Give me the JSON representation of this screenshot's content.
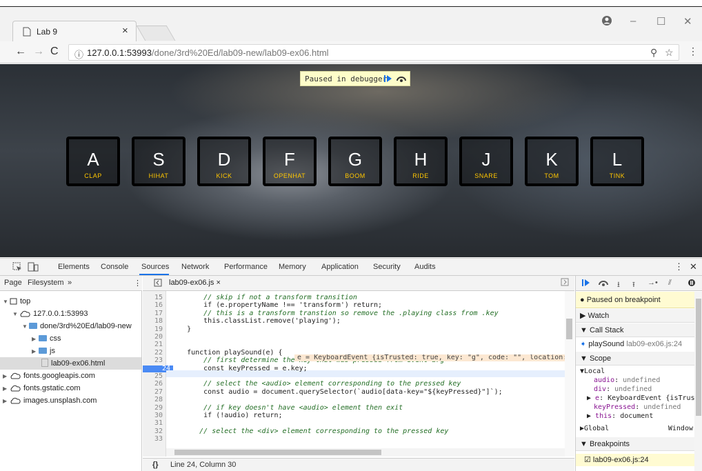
{
  "browser": {
    "tab_title": "Lab 9",
    "url_host": "127.0.0.1:53993",
    "url_path": "/done/3rd%20Ed/lab09-new/lab09-ex06.html"
  },
  "page": {
    "paused_label": "Paused in debugger",
    "keys": [
      {
        "key": "A",
        "sound": "clap"
      },
      {
        "key": "S",
        "sound": "hihat"
      },
      {
        "key": "D",
        "sound": "kick"
      },
      {
        "key": "F",
        "sound": "openhat"
      },
      {
        "key": "G",
        "sound": "boom"
      },
      {
        "key": "H",
        "sound": "ride"
      },
      {
        "key": "J",
        "sound": "snare"
      },
      {
        "key": "K",
        "sound": "tom"
      },
      {
        "key": "L",
        "sound": "tink"
      }
    ]
  },
  "devtools": {
    "tabs": [
      "Elements",
      "Console",
      "Sources",
      "Network",
      "Performance",
      "Memory",
      "Application",
      "Security",
      "Audits"
    ],
    "active_tab": "Sources",
    "navigator": {
      "tabs": [
        "Page",
        "Filesystem",
        "»"
      ],
      "tree": [
        "top",
        "127.0.0.1:53993",
        "done/3rd%20Ed/lab09-new",
        "css",
        "js",
        "lab09-ex06.html",
        "fonts.googleapis.com",
        "fonts.gstatic.com",
        "images.unsplash.com"
      ]
    },
    "editor": {
      "file_tab": "lab09-ex06.js ×",
      "line_numbers": [
        "15",
        "16",
        "17",
        "18",
        "19",
        "20",
        "21",
        "22",
        "23",
        "24",
        "25",
        "26",
        "27",
        "28",
        "29",
        "30",
        "31",
        "32",
        "33"
      ],
      "current_line": "24",
      "lines": [
        "        // skip if not a transform transition",
        "        if (e.propertyName !== 'transform') return;",
        "        // this is a transform transtion so remove the .playing class from .key",
        "        this.classList.remove('playing');",
        "    }",
        "",
        "",
        "    function playSound(e) {",
        "        // first determine the key that was pressed from event arg",
        "        const keyPressed = e.key;",
        "",
        "        // select the <audio> element corresponding to the pressed key",
        "        const audio = document.querySelector(`audio[data-key=\"${keyPressed}\"]`);",
        "",
        "        // if key doesn't have <audio> element then exit",
        "        if (!audio) return;",
        "",
        "       // select the <div> element corresponding to the pressed key",
        ""
      ],
      "inline_value": "e = KeyboardEvent {isTrusted: true, key: \"g\", code: \"\", location:",
      "status": "Line 24, Column 30"
    },
    "debugger": {
      "paused_text": "Paused on breakpoint",
      "watch": "Watch",
      "call_stack": "Call Stack",
      "frame_fn": "playSound",
      "frame_loc": "lab09-ex06.js:24",
      "scope": "Scope",
      "local": "Local",
      "vars": [
        {
          "name": "audio",
          "value": "undefined"
        },
        {
          "name": "div",
          "value": "undefined"
        },
        {
          "name": "e",
          "value": "KeyboardEvent {isTrust"
        },
        {
          "name": "keyPressed",
          "value": "undefined"
        },
        {
          "name": "this",
          "value": "document"
        }
      ],
      "global": "Global",
      "global_val": "Window",
      "breakpoints": "Breakpoints",
      "bp_item": "lab09-ex06.js:24"
    }
  }
}
